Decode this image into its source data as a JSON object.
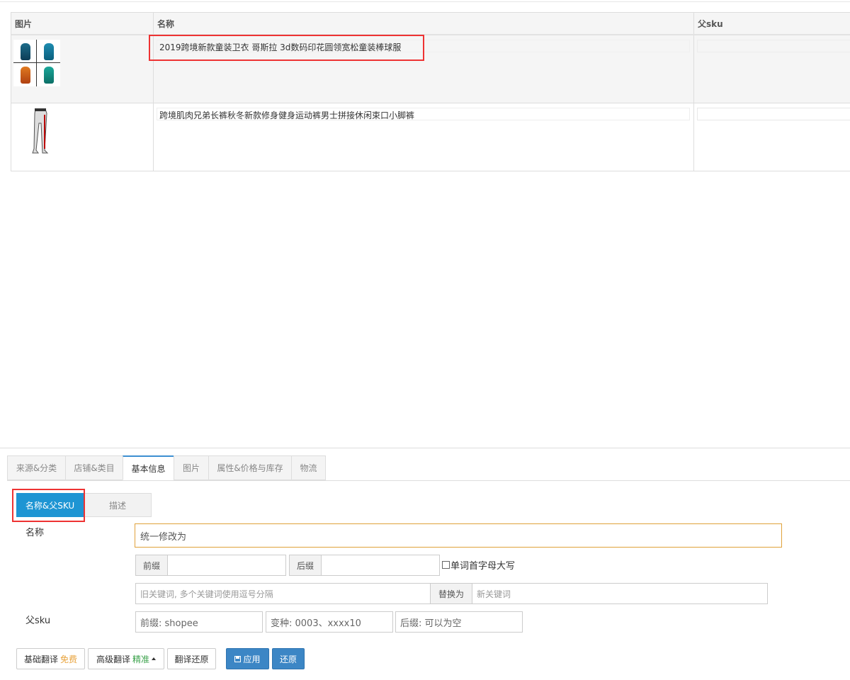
{
  "table": {
    "headers": [
      "图片",
      "名称",
      "父sku"
    ],
    "rows": [
      {
        "name": "2019跨境新款童装卫衣 哥斯拉 3d数码印花圆领宽松童装棒球服",
        "parent_sku": ""
      },
      {
        "name": "跨境肌肉兄弟长裤秋冬新款修身健身运动裤男士拼接休闲束口小脚裤",
        "parent_sku": ""
      }
    ]
  },
  "tabs": [
    "来源&分类",
    "店铺&类目",
    "基本信息",
    "图片",
    "属性&价格与库存",
    "物流"
  ],
  "active_tab": "基本信息",
  "subtabs": [
    "名称&父SKU",
    "描述"
  ],
  "form": {
    "name_label": "名称",
    "name_value": "统一修改为",
    "prefix_label": "前缀",
    "suffix_label": "后缀",
    "capitalize_label": "单词首字母大写",
    "old_keyword_placeholder": "旧关键词, 多个关键词使用逗号分隔",
    "replace_label": "替换为",
    "new_keyword_placeholder": "新关键词",
    "sku_label": "父sku",
    "sku_prefix_placeholder": "前缀: shopee",
    "sku_variant_placeholder": "变种: 0003、xxxx10",
    "sku_suffix_placeholder": "后缀: 可以为空"
  },
  "buttons": {
    "basic_translate": "基础翻译",
    "basic_tag": "免费",
    "advanced_translate": "高级翻译",
    "advanced_tag": "精准",
    "restore_translate": "翻译还原",
    "apply": "应用",
    "restore": "还原"
  },
  "colors": {
    "accent": "#1e95d3",
    "primary_button": "#3c86c5",
    "highlight": "#e33333",
    "input_focus": "#e0a13a"
  }
}
